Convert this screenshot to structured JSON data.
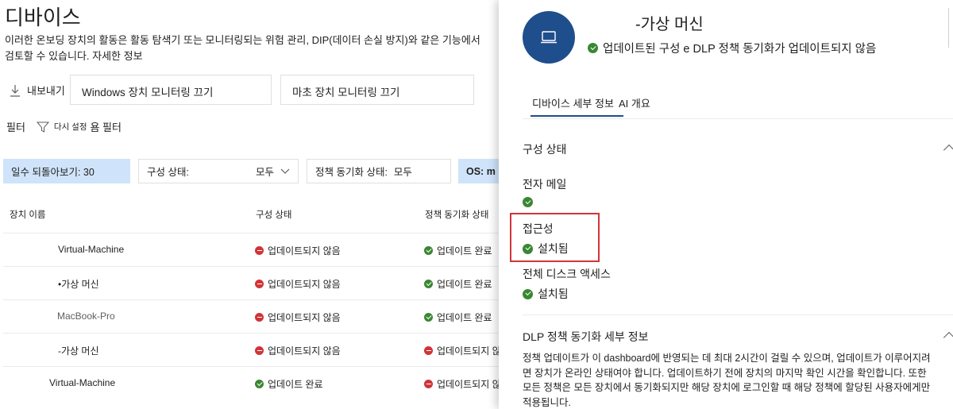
{
  "page": {
    "title": "디바이스",
    "description": "이러한 온보딩 장치의 활동은 활동 탐색기 또는 모니터링되는 위험 관리, DIP(데이터 손실 방지)와 같은 기능에서 검토할 수 있습니다.",
    "more_link": "자세한 정보"
  },
  "commandbar": {
    "export_label": "내보내기",
    "windows_monitoring_label": "Windows 장치 모니터링 끄기",
    "mac_monitoring_label": "마초 장치 모니터링 끄기"
  },
  "filters": {
    "label": "필터",
    "reset_label": "다시 설정",
    "all_filters_label": "욤 필터",
    "chips": {
      "days": "일수 되돌아보기: 30",
      "config_label": "구성 상태:",
      "config_value": "모두",
      "policy_label": "정책 동기화 상태:",
      "policy_value": "모두",
      "os_label": "OS: m"
    }
  },
  "table": {
    "headers": {
      "name": "장치 이름",
      "config": "구성 상태",
      "policy": "정책 동기화 상태"
    },
    "rows": [
      {
        "name": "Virtual-Machine",
        "config": "업데이트되지 않음",
        "config_status": "red",
        "policy": "업데이트 완료",
        "policy_status": "green"
      },
      {
        "name": "•가상 머신",
        "config": "업데이트되지 않음",
        "config_status": "red",
        "policy": "업데이트 완료",
        "policy_status": "green"
      },
      {
        "name": "MacBook-Pro",
        "config": "업데이트되지 않음",
        "config_status": "red",
        "policy": "업데이트 완료",
        "policy_status": "green"
      },
      {
        "name": "-가상 머신",
        "config": "업데이트되지 않음",
        "config_status": "red",
        "policy": "업데이트되지 않음",
        "policy_status": "red"
      },
      {
        "name": "Virtual-Machine",
        "config": "업데이트 완료",
        "config_status": "green",
        "policy": "업데이트되지 않음",
        "policy_status": "red"
      }
    ]
  },
  "panel": {
    "title": "-가상 머신",
    "subtitle": "업데이트된 구성 e DLP 정책 동기화가 업데이트되지 않음",
    "tabs": {
      "details": "디바이스 세부 정보",
      "ai": "AI 개요"
    },
    "config_section": {
      "heading": "구성 상태",
      "email_label": "전자 메일",
      "accessibility_label": "접근성",
      "accessibility_value": "설치됨",
      "disk_label": "전체 디스크 액세스",
      "disk_value": "설치됨"
    },
    "dlp_section": {
      "heading": "DLP 정책 동기화 세부 정보",
      "text": "정책 업데이트가 이 dashboard에 반영되는 데 최대 2시간이 걸릴 수 있으며, 업데이트가 이루어지려면 장치가 온라인 상태여야 합니다. 업데이트하기 전에 장치의 마지막 확인 시간을 확인합니다. 또한 모든 정책은 모든 장치에서 동기화되지만 해당 장치에 로그인할 때 해당 정책에 할당된 사용자에게만 적용됩니다."
    }
  },
  "colors": {
    "accent": "#1f4e8c",
    "success": "#3a8733",
    "error": "#d13438",
    "chip_bg": "#cfe4fa"
  }
}
